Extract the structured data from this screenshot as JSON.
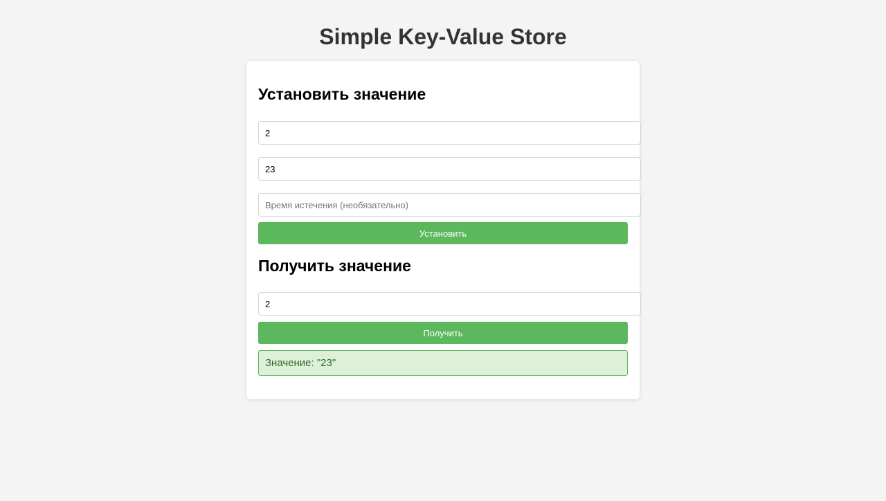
{
  "page": {
    "title": "Simple Key-Value Store"
  },
  "set_section": {
    "heading": "Установить значение",
    "key_value": "2",
    "value_value": "23",
    "ttl_value": "",
    "ttl_placeholder": "Время истечения (необязательно)",
    "button_label": "Установить"
  },
  "get_section": {
    "heading": "Получить значение",
    "key_value": "2",
    "button_label": "Получить",
    "result_text": "Значение: \"23\""
  },
  "colors": {
    "background": "#f4f4f4",
    "card": "#ffffff",
    "button": "#5cb85c",
    "result_background": "#dff0d8",
    "result_text": "#2d6a2d"
  }
}
